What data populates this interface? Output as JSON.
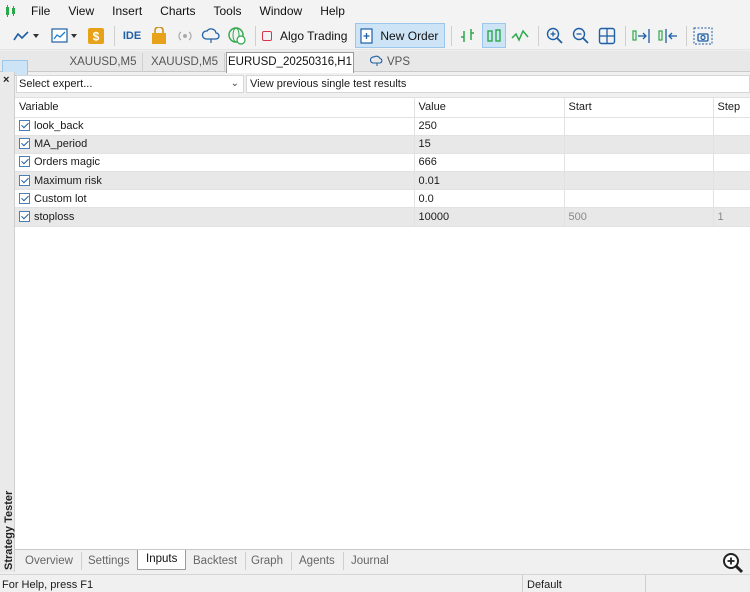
{
  "menu": {
    "items": [
      "File",
      "View",
      "Insert",
      "Charts",
      "Tools",
      "Window",
      "Help"
    ]
  },
  "toolbar": {
    "ide_label": "IDE",
    "algo_trading_label": "Algo Trading",
    "new_order_label": "New Order"
  },
  "chart_tabs": [
    "XAUUSD,M5",
    "XAUUSD,M5",
    "EURUSD_20250316,H1",
    "VPS"
  ],
  "tester": {
    "panel_label": "Strategy Tester",
    "expert_select": "Select expert...",
    "view_previous": "View previous single test results",
    "columns": [
      "Variable",
      "Value",
      "Start",
      "Step"
    ],
    "rows": [
      {
        "variable": "look_back",
        "value": "250",
        "start": "",
        "step": ""
      },
      {
        "variable": "MA_period",
        "value": "15",
        "start": "",
        "step": ""
      },
      {
        "variable": "Orders magic",
        "value": "666",
        "start": "",
        "step": ""
      },
      {
        "variable": "Maximum risk",
        "value": "0.01",
        "start": "",
        "step": ""
      },
      {
        "variable": "Custom lot",
        "value": "0.0",
        "start": "",
        "step": ""
      },
      {
        "variable": "stoploss",
        "value": "10000",
        "start": "500",
        "step": "1"
      }
    ],
    "bottom_tabs": [
      "Overview",
      "Settings",
      "Inputs",
      "Backtest",
      "Graph",
      "Agents",
      "Journal"
    ],
    "active_tab": "Inputs"
  },
  "status": {
    "help": "For Help, press F1",
    "profile": "Default"
  },
  "colors": {
    "accent": "#1f7fd6",
    "active_bg": "#cde4f7",
    "row_alt": "#e8e8e8",
    "green_icon": "#2ba84a"
  }
}
